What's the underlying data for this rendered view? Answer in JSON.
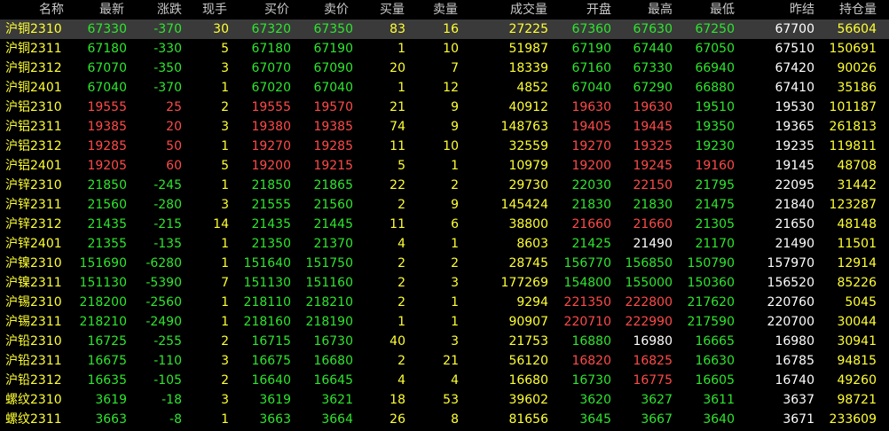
{
  "colors": {
    "up": "#ff4a4a",
    "down": "#2ee62e",
    "flat": "#ffffff",
    "volume": "#ffff33",
    "name": "#ffff33",
    "header": "#c8c8c8",
    "selected_row": "#3a3a3a"
  },
  "columns": [
    {
      "key": "name",
      "label": "名称"
    },
    {
      "key": "last",
      "label": "最新"
    },
    {
      "key": "change",
      "label": "涨跌"
    },
    {
      "key": "cur_vol",
      "label": "现手"
    },
    {
      "key": "bid",
      "label": "买价"
    },
    {
      "key": "ask",
      "label": "卖价"
    },
    {
      "key": "bid_vol",
      "label": "买量"
    },
    {
      "key": "ask_vol",
      "label": "卖量"
    },
    {
      "key": "volume",
      "label": "成交量"
    },
    {
      "key": "open",
      "label": "开盘"
    },
    {
      "key": "high",
      "label": "最高"
    },
    {
      "key": "low",
      "label": "最低"
    },
    {
      "key": "prev_settle",
      "label": "昨结"
    },
    {
      "key": "open_interest",
      "label": "持仓量"
    }
  ],
  "rows": [
    {
      "name": "沪铜2310",
      "last": "67330",
      "change": "-370",
      "cur_vol": "30",
      "bid": "67320",
      "ask": "67350",
      "bid_vol": "83",
      "ask_vol": "16",
      "volume": "27225",
      "open": "67360",
      "high": "67630",
      "low": "67250",
      "prev_settle": "67700",
      "open_interest": "56604",
      "selected": true
    },
    {
      "name": "沪铜2311",
      "last": "67180",
      "change": "-330",
      "cur_vol": "5",
      "bid": "67180",
      "ask": "67190",
      "bid_vol": "1",
      "ask_vol": "10",
      "volume": "51987",
      "open": "67190",
      "high": "67440",
      "low": "67050",
      "prev_settle": "67510",
      "open_interest": "150691"
    },
    {
      "name": "沪铜2312",
      "last": "67070",
      "change": "-350",
      "cur_vol": "3",
      "bid": "67070",
      "ask": "67090",
      "bid_vol": "20",
      "ask_vol": "7",
      "volume": "18339",
      "open": "67160",
      "high": "67330",
      "low": "66940",
      "prev_settle": "67420",
      "open_interest": "90026"
    },
    {
      "name": "沪铜2401",
      "last": "67040",
      "change": "-370",
      "cur_vol": "1",
      "bid": "67020",
      "ask": "67040",
      "bid_vol": "1",
      "ask_vol": "12",
      "volume": "4852",
      "open": "67040",
      "high": "67290",
      "low": "66880",
      "prev_settle": "67410",
      "open_interest": "35186"
    },
    {
      "name": "沪铝2310",
      "last": "19555",
      "change": "25",
      "cur_vol": "2",
      "bid": "19555",
      "ask": "19570",
      "bid_vol": "21",
      "ask_vol": "9",
      "volume": "40912",
      "open": "19630",
      "high": "19630",
      "low": "19510",
      "prev_settle": "19530",
      "open_interest": "101187"
    },
    {
      "name": "沪铝2311",
      "last": "19385",
      "change": "20",
      "cur_vol": "3",
      "bid": "19380",
      "ask": "19385",
      "bid_vol": "74",
      "ask_vol": "9",
      "volume": "148763",
      "open": "19405",
      "high": "19445",
      "low": "19350",
      "prev_settle": "19365",
      "open_interest": "261813"
    },
    {
      "name": "沪铝2312",
      "last": "19285",
      "change": "50",
      "cur_vol": "1",
      "bid": "19270",
      "ask": "19285",
      "bid_vol": "11",
      "ask_vol": "10",
      "volume": "32559",
      "open": "19270",
      "high": "19325",
      "low": "19230",
      "prev_settle": "19235",
      "open_interest": "119811"
    },
    {
      "name": "沪铝2401",
      "last": "19205",
      "change": "60",
      "cur_vol": "5",
      "bid": "19200",
      "ask": "19215",
      "bid_vol": "5",
      "ask_vol": "1",
      "volume": "10979",
      "open": "19200",
      "high": "19245",
      "low": "19160",
      "prev_settle": "19145",
      "open_interest": "48708"
    },
    {
      "name": "沪锌2310",
      "last": "21850",
      "change": "-245",
      "cur_vol": "1",
      "bid": "21850",
      "ask": "21865",
      "bid_vol": "22",
      "ask_vol": "2",
      "volume": "29730",
      "open": "22030",
      "high": "22150",
      "low": "21795",
      "prev_settle": "22095",
      "open_interest": "31442"
    },
    {
      "name": "沪锌2311",
      "last": "21560",
      "change": "-280",
      "cur_vol": "3",
      "bid": "21555",
      "ask": "21560",
      "bid_vol": "2",
      "ask_vol": "9",
      "volume": "145424",
      "open": "21830",
      "high": "21830",
      "low": "21475",
      "prev_settle": "21840",
      "open_interest": "123287"
    },
    {
      "name": "沪锌2312",
      "last": "21435",
      "change": "-215",
      "cur_vol": "14",
      "bid": "21435",
      "ask": "21445",
      "bid_vol": "11",
      "ask_vol": "6",
      "volume": "38800",
      "open": "21660",
      "high": "21660",
      "low": "21305",
      "prev_settle": "21650",
      "open_interest": "48148"
    },
    {
      "name": "沪锌2401",
      "last": "21355",
      "change": "-135",
      "cur_vol": "1",
      "bid": "21350",
      "ask": "21370",
      "bid_vol": "4",
      "ask_vol": "1",
      "volume": "8603",
      "open": "21425",
      "high": "21490",
      "low": "21170",
      "prev_settle": "21490",
      "open_interest": "11501"
    },
    {
      "name": "沪镍2310",
      "last": "151690",
      "change": "-6280",
      "cur_vol": "1",
      "bid": "151640",
      "ask": "151750",
      "bid_vol": "2",
      "ask_vol": "2",
      "volume": "28745",
      "open": "156770",
      "high": "156850",
      "low": "150790",
      "prev_settle": "157970",
      "open_interest": "12914"
    },
    {
      "name": "沪镍2311",
      "last": "151130",
      "change": "-5390",
      "cur_vol": "7",
      "bid": "151130",
      "ask": "151160",
      "bid_vol": "2",
      "ask_vol": "3",
      "volume": "177269",
      "open": "154800",
      "high": "155000",
      "low": "150360",
      "prev_settle": "156520",
      "open_interest": "85226"
    },
    {
      "name": "沪锡2310",
      "last": "218200",
      "change": "-2560",
      "cur_vol": "1",
      "bid": "218110",
      "ask": "218210",
      "bid_vol": "2",
      "ask_vol": "1",
      "volume": "9294",
      "open": "221350",
      "high": "222800",
      "low": "217620",
      "prev_settle": "220760",
      "open_interest": "5045"
    },
    {
      "name": "沪锡2311",
      "last": "218210",
      "change": "-2490",
      "cur_vol": "1",
      "bid": "218160",
      "ask": "218190",
      "bid_vol": "1",
      "ask_vol": "1",
      "volume": "90907",
      "open": "220710",
      "high": "222990",
      "low": "217590",
      "prev_settle": "220700",
      "open_interest": "30044"
    },
    {
      "name": "沪铅2310",
      "last": "16725",
      "change": "-255",
      "cur_vol": "2",
      "bid": "16715",
      "ask": "16730",
      "bid_vol": "40",
      "ask_vol": "3",
      "volume": "21753",
      "open": "16880",
      "high": "16980",
      "low": "16665",
      "prev_settle": "16980",
      "open_interest": "30941"
    },
    {
      "name": "沪铅2311",
      "last": "16675",
      "change": "-110",
      "cur_vol": "3",
      "bid": "16675",
      "ask": "16680",
      "bid_vol": "2",
      "ask_vol": "21",
      "volume": "56120",
      "open": "16820",
      "high": "16825",
      "low": "16630",
      "prev_settle": "16785",
      "open_interest": "94815"
    },
    {
      "name": "沪铅2312",
      "last": "16635",
      "change": "-105",
      "cur_vol": "2",
      "bid": "16640",
      "ask": "16645",
      "bid_vol": "4",
      "ask_vol": "4",
      "volume": "16680",
      "open": "16730",
      "high": "16775",
      "low": "16605",
      "prev_settle": "16740",
      "open_interest": "49260"
    },
    {
      "name": "螺纹2310",
      "last": "3619",
      "change": "-18",
      "cur_vol": "3",
      "bid": "3619",
      "ask": "3621",
      "bid_vol": "18",
      "ask_vol": "53",
      "volume": "39602",
      "open": "3620",
      "high": "3627",
      "low": "3611",
      "prev_settle": "3637",
      "open_interest": "98721"
    },
    {
      "name": "螺纹2311",
      "last": "3663",
      "change": "-8",
      "cur_vol": "1",
      "bid": "3663",
      "ask": "3664",
      "bid_vol": "26",
      "ask_vol": "8",
      "volume": "81656",
      "open": "3645",
      "high": "3667",
      "low": "3640",
      "prev_settle": "3671",
      "open_interest": "233609"
    }
  ]
}
